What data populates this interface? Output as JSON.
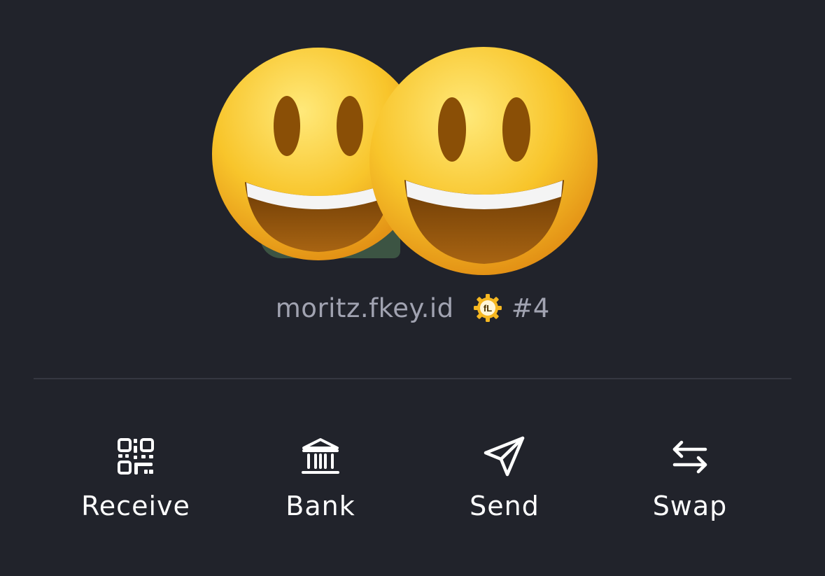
{
  "profile": {
    "avatars": [
      "grinning-face-emoji",
      "grinning-face-emoji"
    ],
    "username": "moritz.fkey.id",
    "badge_icon": "gear-badge-icon",
    "badge_text": "fL",
    "rank": "#4"
  },
  "actions": [
    {
      "label": "Receive",
      "icon": "qr-code-icon"
    },
    {
      "label": "Bank",
      "icon": "bank-icon"
    },
    {
      "label": "Send",
      "icon": "send-icon"
    },
    {
      "label": "Swap",
      "icon": "swap-icon"
    }
  ],
  "colors": {
    "background": "#21232b",
    "muted_text": "#a1a3b1",
    "label_text": "#ffffff",
    "divider": "#353741",
    "emoji_yellow": "#f8c52b",
    "badge_gold": "#f5b721"
  }
}
